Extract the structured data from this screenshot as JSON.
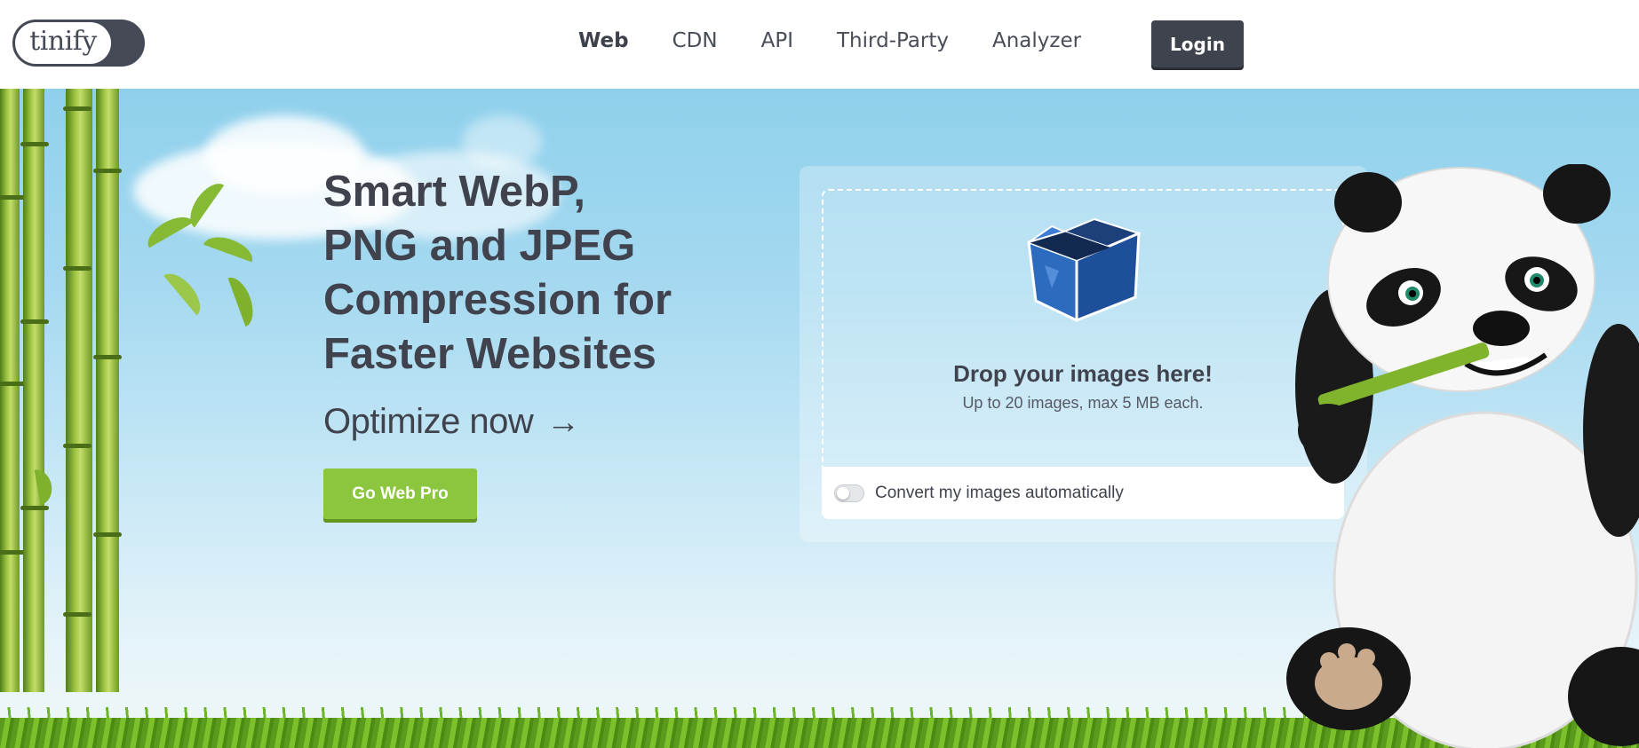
{
  "header": {
    "logo_text": "tinify",
    "nav": [
      {
        "label": "Web",
        "active": true
      },
      {
        "label": "CDN",
        "active": false
      },
      {
        "label": "API",
        "active": false
      },
      {
        "label": "Third-Party",
        "active": false
      },
      {
        "label": "Analyzer",
        "active": false
      }
    ],
    "login_label": "Login"
  },
  "hero": {
    "headline_lines": [
      "Smart WebP,",
      "PNG and JPEG",
      "Compression for",
      "Faster Websites"
    ],
    "optimize_label": "Optimize now",
    "optimize_arrow": "→",
    "pro_button_label": "Go Web Pro"
  },
  "dropzone": {
    "title": "Drop your images here!",
    "subtitle": "Up to 20 images, max 5 MB each.",
    "icon": "box-icon",
    "convert_label": "Convert my images automatically",
    "convert_enabled": false
  },
  "colors": {
    "text_dark": "#40434d",
    "login_bg": "#3f434e",
    "pro_green": "#8cc63f",
    "sky": "#8fd0ec"
  }
}
